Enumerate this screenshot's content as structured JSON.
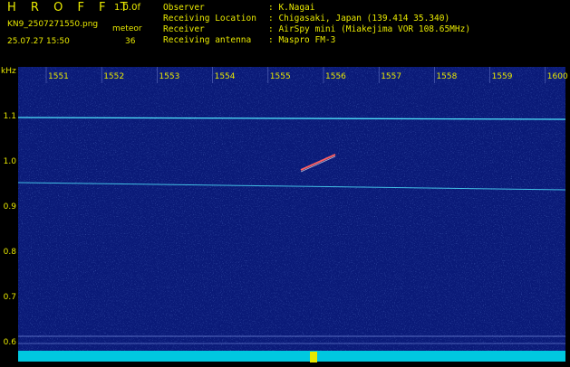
{
  "header": {
    "app_title": "H R O F F T",
    "version": "1.0.0f",
    "filename": "KN9_2507271550.png",
    "mode": "meteor",
    "datetime": "25.07.27 15:50",
    "count": "36",
    "info_rows": [
      {
        "label": "Observer",
        "value": ": K.Nagai"
      },
      {
        "label": "Receiving Location",
        "value": ": Chigasaki, Japan (139.414 35.340)"
      },
      {
        "label": "Receiver",
        "value": ": AirSpy mini (Miakejima VOR 108.65MHz)"
      },
      {
        "label": "Receiving antenna",
        "value": ": Maspro FM-3"
      }
    ]
  },
  "axes": {
    "y_unit": "kHz",
    "y_ticks": [
      "1.1",
      "1.0",
      "0.9",
      "0.8",
      "0.7",
      "0.6"
    ],
    "x_ticks": [
      "1551",
      "1552",
      "1553",
      "1554",
      "1555",
      "1556",
      "1557",
      "1558",
      "1559",
      "1600"
    ]
  },
  "colors": {
    "text": "#e8e800",
    "background": "#0a1a78",
    "carrier_line": "#50e8ff"
  }
}
